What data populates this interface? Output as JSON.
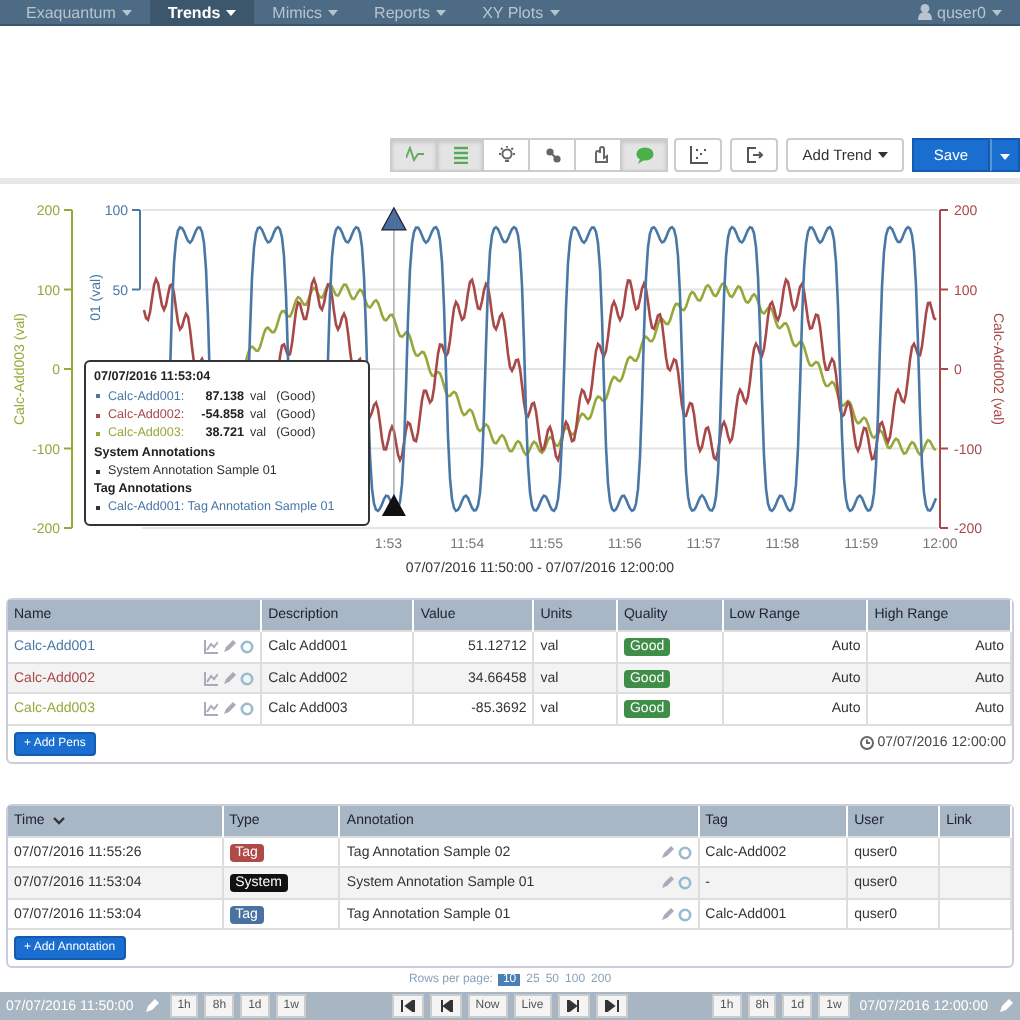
{
  "navbar": {
    "menus": [
      {
        "label": "Exaquantum",
        "selected": false
      },
      {
        "label": "Trends",
        "selected": true
      },
      {
        "label": "Mimics",
        "selected": false
      },
      {
        "label": "Reports",
        "selected": false
      },
      {
        "label": "XY Plots",
        "selected": false
      }
    ],
    "user": "quser0"
  },
  "toolbar": {
    "toggles": [
      {
        "kind": "trend",
        "active": true
      },
      {
        "kind": "list",
        "active": true
      },
      {
        "kind": "bulb",
        "active": false
      },
      {
        "kind": "link",
        "active": false
      },
      {
        "kind": "cursor",
        "active": false
      },
      {
        "kind": "comment",
        "active": true
      },
      {
        "kind": "chart",
        "active": false
      },
      {
        "kind": "exit",
        "active": false
      }
    ],
    "add_trend": "Add Trend",
    "save": "Save"
  },
  "chart": {
    "left_outer_axis": {
      "title": "Calc-Add003 (val)",
      "ticks": [
        "200",
        "100",
        "0",
        "-100",
        "-200"
      ]
    },
    "left_inner_axis": {
      "title": "01 (val)",
      "ticks": [
        "100",
        "50"
      ]
    },
    "right_axis": {
      "title": "Calc-Add002 (val)",
      "ticks": [
        "200",
        "100",
        "0",
        "-100",
        "-200"
      ]
    },
    "x_ticks": [
      "1:53",
      "11:54",
      "11:55",
      "11:56",
      "11:57",
      "11:58",
      "11:59",
      "12:00"
    ],
    "range": "07/07/2016 11:50:00 - 07/07/2016 12:00:00"
  },
  "tooltip": {
    "time": "07/07/2016 11:53:04",
    "rows": [
      {
        "name": "Calc-Add001:",
        "value": "87.138",
        "unit": "val",
        "quality": "(Good)",
        "color": "#4a78a6"
      },
      {
        "name": "Calc-Add002:",
        "value": "-54.858",
        "unit": "val",
        "quality": "(Good)",
        "color": "#a84848"
      },
      {
        "name": "Calc-Add003:",
        "value": "38.721",
        "unit": "val",
        "quality": "(Good)",
        "color": "#97a83a"
      }
    ],
    "system_heading": "System Annotations",
    "system_items": [
      "System Annotation Sample 01"
    ],
    "tag_heading": "Tag Annotations",
    "tag_items": [
      "Calc-Add001: Tag Annotation Sample 01"
    ]
  },
  "pens": {
    "columns": [
      "Name",
      "Description",
      "Value",
      "Units",
      "Quality",
      "Low Range",
      "High Range"
    ],
    "rows": [
      {
        "name": "Calc-Add001",
        "color": "#4a78a6",
        "description": "Calc Add001",
        "value": "51.12712",
        "units": "val",
        "quality": "Good",
        "low_range": "Auto",
        "high_range": "Auto"
      },
      {
        "name": "Calc-Add002",
        "color": "#a84848",
        "description": "Calc Add002",
        "value": "34.66458",
        "units": "val",
        "quality": "Good",
        "low_range": "Auto",
        "high_range": "Auto"
      },
      {
        "name": "Calc-Add003",
        "color": "#97a83a",
        "description": "Calc Add003",
        "value": "-85.3692",
        "units": "val",
        "quality": "Good",
        "low_range": "Auto",
        "high_range": "Auto"
      }
    ],
    "add_button": "+ Add Pens",
    "timestamp": "07/07/2016 12:00:00"
  },
  "annotations": {
    "columns": [
      "Time",
      "Type",
      "Annotation",
      "Tag",
      "User",
      "Link"
    ],
    "rows": [
      {
        "time": "07/07/2016 11:55:26",
        "type": "Tag",
        "color": "#b04a48",
        "annotation": "Tag Annotation Sample 02",
        "tag": "Calc-Add002",
        "user": "quser0"
      },
      {
        "time": "07/07/2016 11:53:04",
        "type": "System",
        "color": "#111111",
        "annotation": "System Annotation Sample 01",
        "tag": "-",
        "user": "quser0"
      },
      {
        "time": "07/07/2016 11:53:04",
        "type": "Tag",
        "color": "#4a72a0",
        "annotation": "Tag Annotation Sample 01",
        "tag": "Calc-Add001",
        "user": "quser0"
      }
    ],
    "add_button": "+ Add Annotation"
  },
  "pager": {
    "label": "Rows per page:",
    "options": [
      {
        "label": "10",
        "selected": true
      },
      {
        "label": "25",
        "selected": false
      },
      {
        "label": "50",
        "selected": false
      },
      {
        "label": "100",
        "selected": false
      },
      {
        "label": "200",
        "selected": false
      }
    ]
  },
  "bottom_bar": {
    "start": "07/07/2016 11:50:00",
    "left_spans": [
      "1h",
      "8h",
      "1d",
      "1w"
    ],
    "nav": [
      {
        "kind": "first"
      },
      {
        "kind": "prev"
      },
      {
        "kind": "text",
        "label": "Now"
      },
      {
        "kind": "text",
        "label": "Live"
      },
      {
        "kind": "next"
      },
      {
        "kind": "last"
      }
    ],
    "right_spans": [
      "1h",
      "8h",
      "1d",
      "1w"
    ],
    "end": "07/07/2016 12:00:00"
  }
}
